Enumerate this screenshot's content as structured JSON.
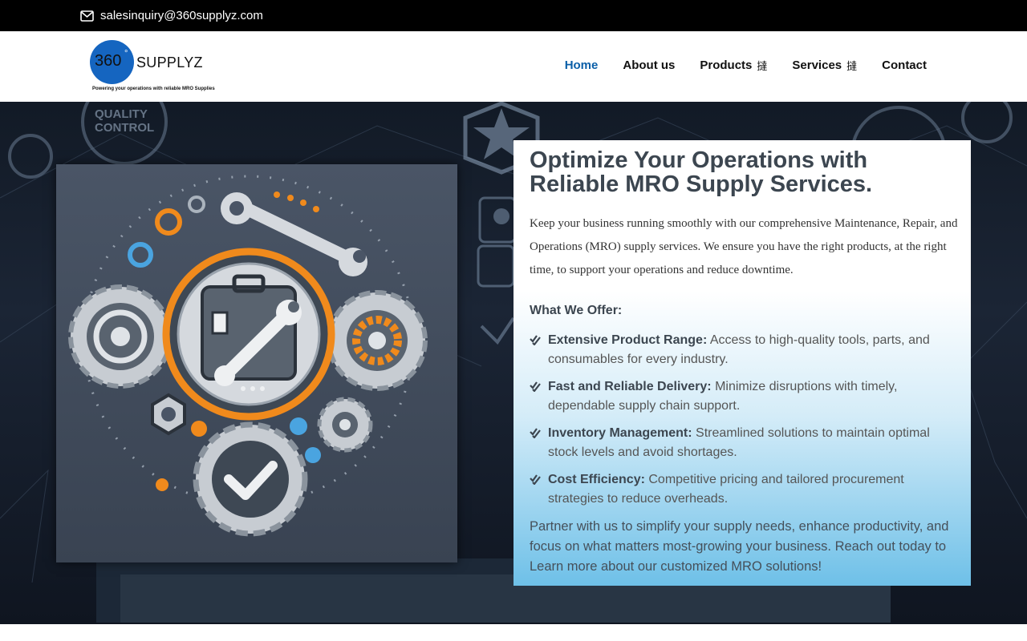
{
  "topbar": {
    "email": "salesinquiry@360supplyz.com",
    "email_icon": "envelope-icon"
  },
  "logo": {
    "number": "360",
    "degree": "°",
    "brand": "SUPPLYZ",
    "tagline": "Powering your operations with reliable MRO Supplies"
  },
  "nav": {
    "items": [
      {
        "label": "Home",
        "active": true
      },
      {
        "label": "About us"
      },
      {
        "label": "Products",
        "caret": "撻"
      },
      {
        "label": "Services",
        "caret": "撻"
      },
      {
        "label": "Contact"
      }
    ]
  },
  "hero": {
    "title": "Optimize Your Operations with Reliable MRO Supply Services.",
    "intro": "Keep your business running smoothly with our comprehensive Maintenance, Repair, and Operations (MRO) supply services. We ensure you have the right products, at the right time, to support your operations and reduce downtime.",
    "offer_heading": "What We Offer:",
    "offers": [
      {
        "title": "Extensive Product Range:",
        "text": " Access to high-quality tools, parts, and consumables for every industry."
      },
      {
        "title": "Fast and Reliable Delivery:",
        "text": " Minimize disruptions with timely, dependable supply chain support."
      },
      {
        "title": "Inventory Management:",
        "text": " Streamlined solutions to maintain optimal stock levels and avoid shortages."
      },
      {
        "title": "Cost Efficiency:",
        "text": " Competitive pricing and tailored procurement strategies to reduce overheads."
      }
    ],
    "outro": "Partner with us to simplify your supply needs, enhance productivity, and focus on what matters most-growing your business. Reach out today to Learn more about our customized MRO solutions!",
    "bg_text": "QUALITY CONTROL"
  },
  "colors": {
    "topbar": "#000000",
    "nav_active": "#0b5fa8",
    "logo_blue": "#1565c0",
    "gear_orange": "#f08a1c",
    "panel_blue": "#6ec0e8"
  }
}
